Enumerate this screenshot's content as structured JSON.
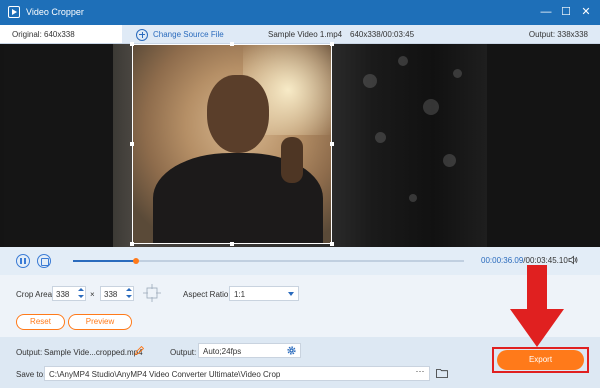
{
  "window": {
    "title": "Video Cropper",
    "minimize_glyph": "—",
    "maximize_glyph": "☐",
    "close_glyph": "✕"
  },
  "infobar": {
    "original_label": "Original: 640x338",
    "change_source_label": "Change Source File",
    "file_name": "Sample Video 1.mp4",
    "file_meta": "640x338/00:03:45",
    "output_size_label": "Output: 338x338"
  },
  "player": {
    "progress": 0.16,
    "current_time": "00:00:36.09",
    "total_time": "00:03:45.10",
    "time_separator": "/"
  },
  "crop": {
    "area_label": "Crop Area:",
    "width": "338",
    "times": "×",
    "height": "338",
    "aspect_label": "Aspect Ratio:",
    "aspect_value": "1:1",
    "reset_label": "Reset",
    "preview_label": "Preview"
  },
  "output": {
    "name_label": "Output:",
    "name_value": "Sample Vide...cropped.mp4",
    "format_label": "Output:",
    "format_value": "Auto;24fps",
    "save_label": "Save to:",
    "save_path": "C:\\AnyMP4 Studio\\AnyMP4 Video Converter Ultimate\\Video Crop",
    "more_label": "···",
    "export_label": "Export"
  },
  "colors": {
    "titlebar": "#1e6fb8",
    "accent": "#2a6bbd",
    "export": "#ff7a1a",
    "annotation": "#e02020"
  }
}
